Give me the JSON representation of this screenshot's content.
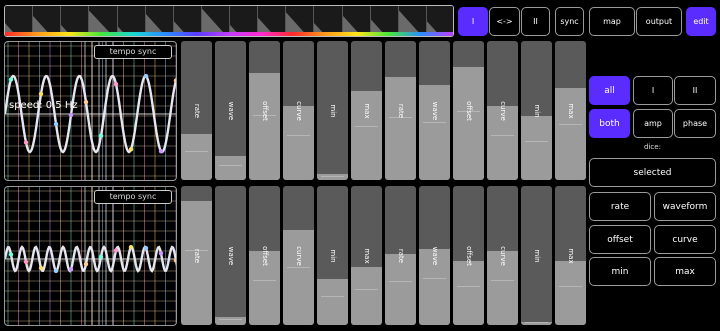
{
  "top_strip": {
    "cells": 16
  },
  "channel_buttons": {
    "one": "I",
    "both": "<->",
    "two": "II"
  },
  "sync_label": "sync",
  "map_label": "map",
  "output_label": "output",
  "edit_label": "edit",
  "select": {
    "all": "all",
    "one": "I",
    "two": "II"
  },
  "mode": {
    "both": "both",
    "amp": "amp",
    "phase": "phase"
  },
  "dice_label": "dice:",
  "selected_label": "selected",
  "dice_buttons": {
    "rate": "rate",
    "waveform": "waveform",
    "offset": "offset",
    "curve": "curve",
    "min": "min",
    "max": "max"
  },
  "scopes": [
    {
      "tempo_label": "tempo sync",
      "speed_text": "speed: 0.5 Hz"
    },
    {
      "tempo_label": "tempo sync",
      "speed_text": ""
    }
  ],
  "sliders_row1": [
    {
      "label": "rate",
      "value": 0.33
    },
    {
      "label": "wave",
      "value": 0.17
    },
    {
      "label": "offset",
      "value": 0.77
    },
    {
      "label": "curve",
      "value": 0.53
    },
    {
      "label": "min",
      "value": 0.04
    },
    {
      "label": "max",
      "value": 0.64
    },
    {
      "label": "rate",
      "value": 0.74
    },
    {
      "label": "wave",
      "value": 0.68
    },
    {
      "label": "offset",
      "value": 0.81
    },
    {
      "label": "curve",
      "value": 0.53
    },
    {
      "label": "min",
      "value": 0.46
    },
    {
      "label": "max",
      "value": 0.66
    }
  ],
  "sliders_row2": [
    {
      "label": "rate",
      "value": 0.89
    },
    {
      "label": "wave",
      "value": 0.06
    },
    {
      "label": "offset",
      "value": 0.53
    },
    {
      "label": "curve",
      "value": 0.68
    },
    {
      "label": "min",
      "value": 0.33
    },
    {
      "label": "max",
      "value": 0.42
    },
    {
      "label": "rate",
      "value": 0.51
    },
    {
      "label": "wave",
      "value": 0.55
    },
    {
      "label": "offset",
      "value": 0.46
    },
    {
      "label": "curve",
      "value": 0.53
    },
    {
      "label": "min",
      "value": 0.02
    },
    {
      "label": "max",
      "value": 0.46
    }
  ],
  "colors": {
    "accent": "#5a2cff",
    "slider_track": "#5a5a5a",
    "slider_fill": "#9b9b9b"
  }
}
